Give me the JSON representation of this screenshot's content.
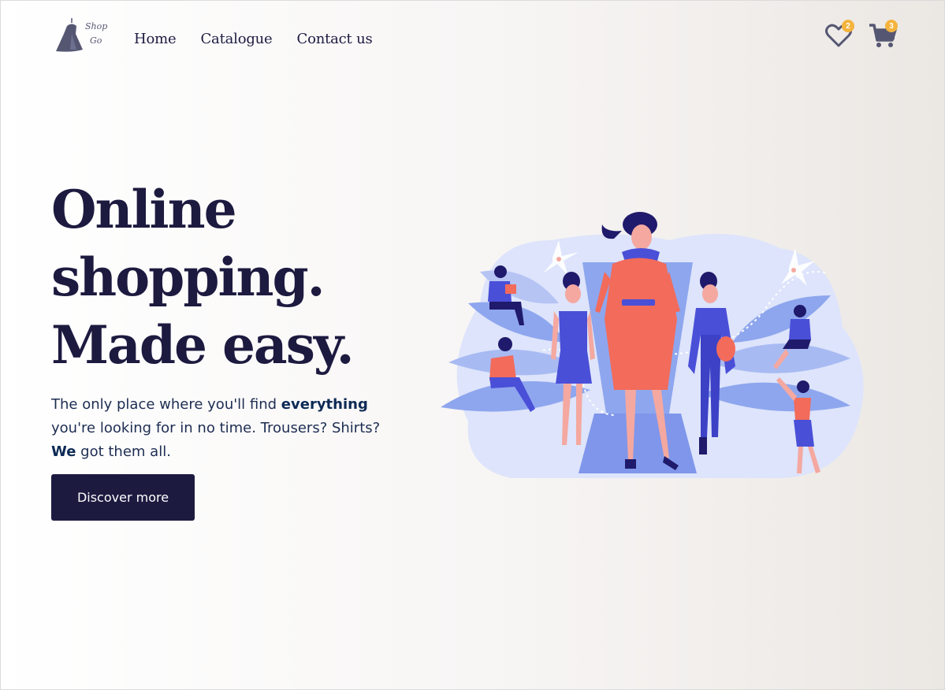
{
  "logo": {
    "line1": "Shop",
    "line2": "Go"
  },
  "nav": {
    "home": "Home",
    "catalogue": "Catalogue",
    "contact": "Contact us"
  },
  "header": {
    "wishlist_count": "2",
    "cart_count": "3",
    "wishlist_icon": "heart-icon",
    "cart_icon": "cart-icon"
  },
  "hero": {
    "title_line1": "Online",
    "title_line2": "shopping.",
    "title_line3": "Made easy.",
    "desc_part1": "The only place where you'll find ",
    "desc_bold1": "everything",
    "desc_part2": " you're looking for in no time. Trousers? Shirts? ",
    "desc_bold2": "We",
    "desc_part3": " got them all.",
    "cta_label": "Discover more"
  },
  "colors": {
    "primary": "#1d1a40",
    "badge": "#f4b33d",
    "accent_coral": "#f26b5b",
    "accent_blue": "#4a4fd8"
  }
}
